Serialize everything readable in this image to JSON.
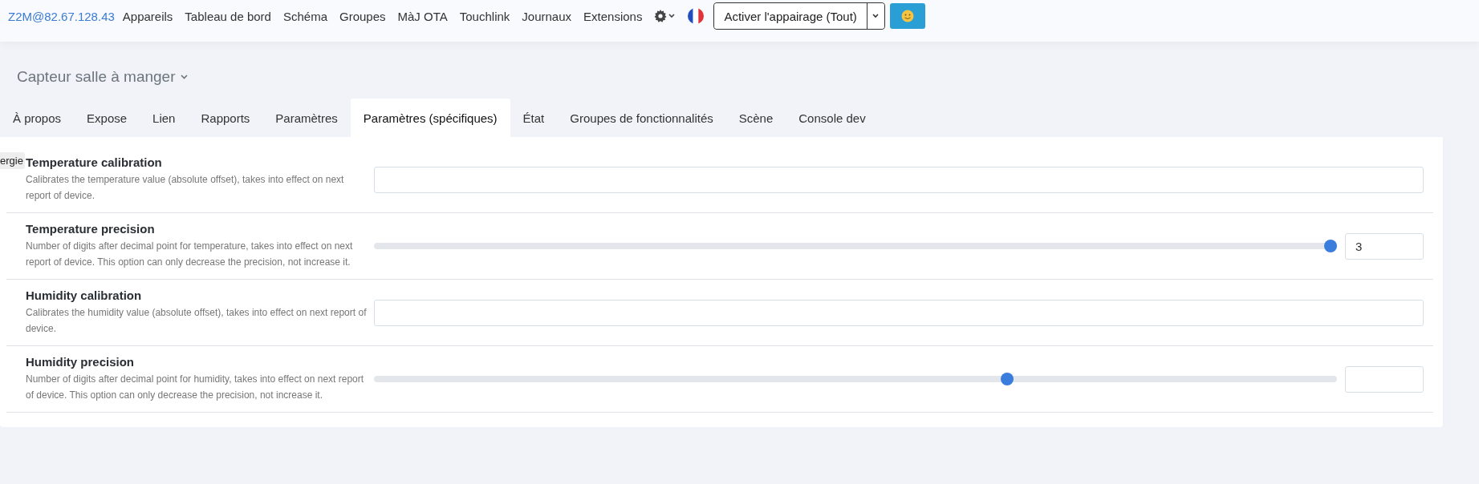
{
  "navbar": {
    "brand": "Z2M@82.67.128.43",
    "links": [
      "Appareils",
      "Tableau de bord",
      "Schéma",
      "Groupes",
      "MàJ OTA",
      "Touchlink",
      "Journaux",
      "Extensions"
    ],
    "pairing_button": "Activer l'appairage (Tout)"
  },
  "device": {
    "title": "Capteur salle à manger"
  },
  "tabs": [
    {
      "label": "À propos",
      "selected": false
    },
    {
      "label": "Expose",
      "selected": false
    },
    {
      "label": "Lien",
      "selected": false
    },
    {
      "label": "Rapports",
      "selected": false
    },
    {
      "label": "Paramètres",
      "selected": false
    },
    {
      "label": "Paramètres (spécifiques)",
      "selected": true
    },
    {
      "label": "État",
      "selected": false
    },
    {
      "label": "Groupes de fonctionnalités",
      "selected": false
    },
    {
      "label": "Scène",
      "selected": false
    },
    {
      "label": "Console dev",
      "selected": false
    }
  ],
  "settings": [
    {
      "kind": "text",
      "name": "Temperature calibration",
      "description": "Calibrates the temperature value (absolute offset), takes into effect on next report of device."
    },
    {
      "kind": "slider",
      "name": "Temperature precision",
      "description": "Number of digits after decimal point for temperature, takes into effect on next report of device. This option can only decrease the precision, not increase it.",
      "level": 1,
      "value": "3"
    },
    {
      "kind": "text",
      "name": "Humidity calibration",
      "description": "Calibrates the humidity value (absolute offset), takes into effect on next report of device."
    },
    {
      "kind": "slider",
      "name": "Humidity precision",
      "description": "Number of digits after decimal point for humidity, takes into effect on next report of device. This option can only decrease the precision, not increase it.",
      "level": 0.66
    }
  ],
  "tooltip": {
    "text": "ergie"
  }
}
